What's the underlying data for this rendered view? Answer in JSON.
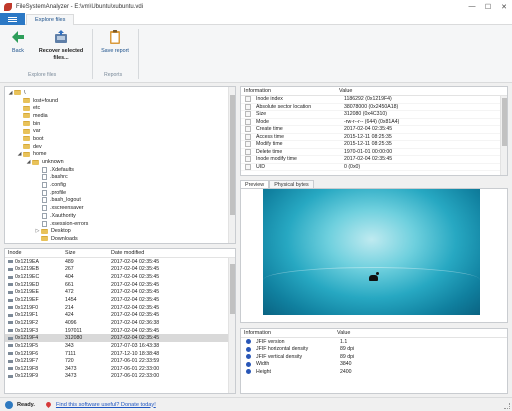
{
  "window": {
    "title": "FileSystemAnalyzer - E:\\vm\\Ubuntu\\xubuntu.vdi"
  },
  "controls": {
    "minimize": "—",
    "maximize": "☐",
    "close": "✕"
  },
  "menubar": {
    "tab": "Explore files"
  },
  "ribbon": {
    "back": "Back",
    "recover_line1": "Recover selected",
    "recover_line2": "files...",
    "save_report": "Save report",
    "group_explore": "Explore files",
    "group_reports": "Reports"
  },
  "tree": [
    {
      "label": "\\",
      "toggle": "◢",
      "indent": 0,
      "kind": "folder"
    },
    {
      "label": "lost+found",
      "toggle": "",
      "indent": 1,
      "kind": "folder"
    },
    {
      "label": "etc",
      "toggle": "",
      "indent": 1,
      "kind": "folder"
    },
    {
      "label": "media",
      "toggle": "",
      "indent": 1,
      "kind": "folder"
    },
    {
      "label": "bin",
      "toggle": "",
      "indent": 1,
      "kind": "folder"
    },
    {
      "label": "var",
      "toggle": "",
      "indent": 1,
      "kind": "folder"
    },
    {
      "label": "boot",
      "toggle": "",
      "indent": 1,
      "kind": "folder"
    },
    {
      "label": "dev",
      "toggle": "",
      "indent": 1,
      "kind": "folder"
    },
    {
      "label": "home",
      "toggle": "◢",
      "indent": 1,
      "kind": "folder"
    },
    {
      "label": "unknown",
      "toggle": "◢",
      "indent": 2,
      "kind": "folder"
    },
    {
      "label": ".Xdefaults",
      "toggle": "",
      "indent": 3,
      "kind": "file"
    },
    {
      "label": ".bashrc",
      "toggle": "",
      "indent": 3,
      "kind": "file"
    },
    {
      "label": ".config",
      "toggle": "",
      "indent": 3,
      "kind": "file"
    },
    {
      "label": ".profile",
      "toggle": "",
      "indent": 3,
      "kind": "file"
    },
    {
      "label": ".bash_logout",
      "toggle": "",
      "indent": 3,
      "kind": "file"
    },
    {
      "label": ".xscreensaver",
      "toggle": "",
      "indent": 3,
      "kind": "file"
    },
    {
      "label": ".Xauthority",
      "toggle": "",
      "indent": 3,
      "kind": "file"
    },
    {
      "label": ".xsession-errors",
      "toggle": "",
      "indent": 3,
      "kind": "file"
    },
    {
      "label": "Desktop",
      "toggle": "▷",
      "indent": 3,
      "kind": "folder"
    },
    {
      "label": "Downloads",
      "toggle": "",
      "indent": 3,
      "kind": "folder"
    },
    {
      "label": "Templates",
      "toggle": "",
      "indent": 3,
      "kind": "folder"
    }
  ],
  "inode_list": {
    "headers": {
      "inode": "Inode",
      "size": "Size",
      "modified": "Date modified"
    },
    "rows": [
      {
        "inode": "0x1219EA",
        "size": "489",
        "modified": "2017-02-04 02:35:45"
      },
      {
        "inode": "0x1219EB",
        "size": "267",
        "modified": "2017-02-04 02:35:45"
      },
      {
        "inode": "0x1219EC",
        "size": "404",
        "modified": "2017-02-04 02:35:45"
      },
      {
        "inode": "0x1219ED",
        "size": "661",
        "modified": "2017-02-04 02:35:45"
      },
      {
        "inode": "0x1219EE",
        "size": "472",
        "modified": "2017-02-04 02:35:45"
      },
      {
        "inode": "0x1219EF",
        "size": "1454",
        "modified": "2017-02-04 02:35:45"
      },
      {
        "inode": "0x1219F0",
        "size": "214",
        "modified": "2017-02-04 02:35:45"
      },
      {
        "inode": "0x1219F1",
        "size": "424",
        "modified": "2017-02-04 02:35:45"
      },
      {
        "inode": "0x1219F2",
        "size": "4096",
        "modified": "2017-02-04 02:36:38"
      },
      {
        "inode": "0x1219F3",
        "size": "197011",
        "modified": "2017-02-04 02:35:45"
      },
      {
        "inode": "0x1219F4",
        "size": "312080",
        "modified": "2017-02-04 02:35:45",
        "selected": true
      },
      {
        "inode": "0x1219F5",
        "size": "343",
        "modified": "2017-07-03 16:43:38"
      },
      {
        "inode": "0x1219F6",
        "size": "7111",
        "modified": "2017-12-10 18:38:48"
      },
      {
        "inode": "0x1219F7",
        "size": "720",
        "modified": "2017-06-01 22:33:59"
      },
      {
        "inode": "0x1219F8",
        "size": "3473",
        "modified": "2017-06-01 22:33:00"
      },
      {
        "inode": "0x1219F9",
        "size": "3473",
        "modified": "2017-06-01 22:33:00"
      }
    ]
  },
  "info": {
    "headers": {
      "info": "Information",
      "value": "Value"
    },
    "rows": [
      {
        "label": "Inode index",
        "value": "1186292 (0x1219F4)"
      },
      {
        "label": "Absolute sector location",
        "value": "38078000 (0x2450A18)"
      },
      {
        "label": "Size",
        "value": "312080 (0x4C310)"
      },
      {
        "label": "Mode",
        "value": "-rw-r--r-- (644) (0x81A4)"
      },
      {
        "label": "Create time",
        "value": "2017-02-04 02:35:45"
      },
      {
        "label": "Access time",
        "value": "2015-12-11 08:25:35"
      },
      {
        "label": "Modify time",
        "value": "2015-12-11 08:25:35"
      },
      {
        "label": "Delete time",
        "value": "1970-01-01 00:00:00"
      },
      {
        "label": "Inode modify time",
        "value": "2017-02-04 02:35:45"
      },
      {
        "label": "UID",
        "value": "0 (0x0)"
      }
    ]
  },
  "preview_tabs": {
    "preview": "Preview",
    "physical": "Physical bytes"
  },
  "jfif": {
    "headers": {
      "info": "Information",
      "value": "Value"
    },
    "rows": [
      {
        "label": "JFIF version",
        "value": "1.1"
      },
      {
        "label": "JFIF horizontal density",
        "value": "89 dpi"
      },
      {
        "label": "JFIF vertical density",
        "value": "89 dpi"
      },
      {
        "label": "Width",
        "value": "3840"
      },
      {
        "label": "Height",
        "value": "2400"
      }
    ]
  },
  "status": {
    "ready": "Ready.",
    "donate": "Find this software useful? Donate today!"
  }
}
